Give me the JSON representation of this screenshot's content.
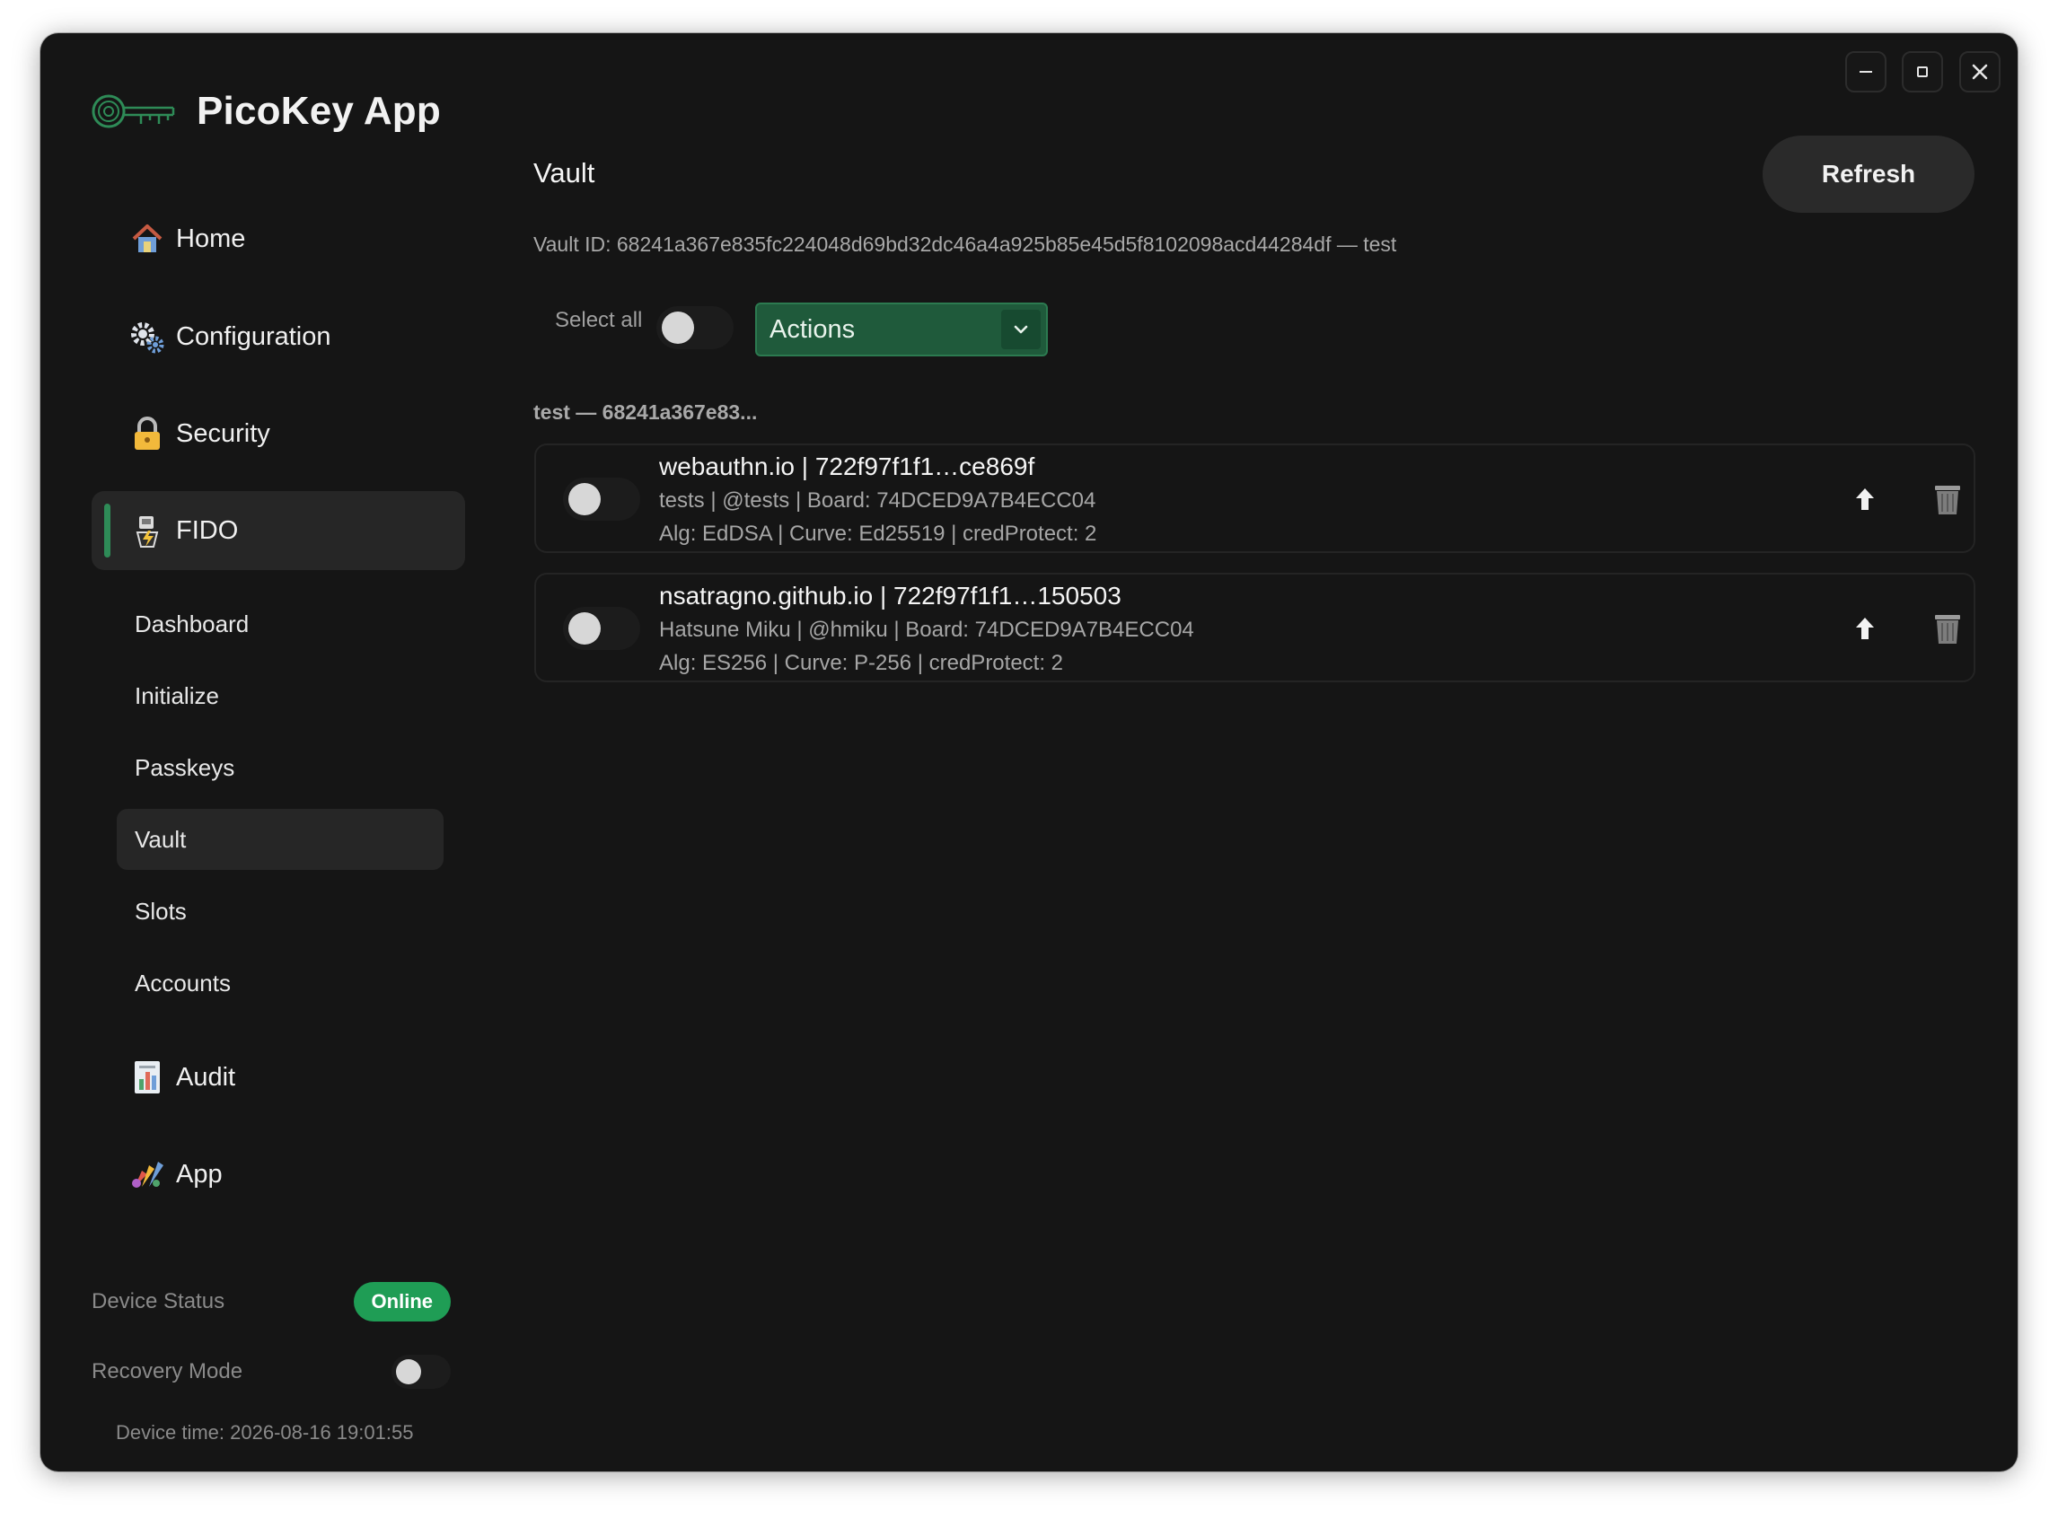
{
  "app": {
    "title": "PicoKey App"
  },
  "window_controls": {
    "minimize_icon": "minimize-icon",
    "maximize_icon": "maximize-icon",
    "close_icon": "close-icon"
  },
  "sidebar": {
    "items": [
      {
        "label": "Home",
        "icon": "house-icon"
      },
      {
        "label": "Configuration",
        "icon": "gear-icon"
      },
      {
        "label": "Security",
        "icon": "lock-icon"
      },
      {
        "label": "FIDO",
        "icon": "fido-key-icon"
      },
      {
        "label": "Audit",
        "icon": "chart-icon"
      },
      {
        "label": "App",
        "icon": "palette-icon"
      }
    ],
    "fido_subitems": [
      {
        "label": "Dashboard"
      },
      {
        "label": "Initialize"
      },
      {
        "label": "Passkeys"
      },
      {
        "label": "Vault"
      },
      {
        "label": "Slots"
      },
      {
        "label": "Accounts"
      }
    ],
    "device_status_label": "Device Status",
    "device_status_value": "Online",
    "recovery_mode_label": "Recovery Mode",
    "recovery_mode_on": false,
    "device_time": "Device time: 2026-08-16 19:01:55"
  },
  "main": {
    "title": "Vault",
    "refresh_label": "Refresh",
    "vault_id": "Vault ID: 68241a367e835fc224048d69bd32dc46a4a925b85e45d5f8102098acd44284df — test",
    "select_all_label": "Select all",
    "actions_label": "Actions",
    "group_label": "test — 68241a367e83...",
    "credentials": [
      {
        "line1": "webauthn.io  |  722f97f1f1…ce869f",
        "line2": "tests  |  @tests  |  Board: 74DCED9A7B4ECC04",
        "line3": "Alg: EdDSA  |  Curve: Ed25519  |  credProtect: 2"
      },
      {
        "line1": "nsatragno.github.io  |  722f97f1f1…150503",
        "line2": "Hatsune Miku  |  @hmiku  |  Board: 74DCED9A7B4ECC04",
        "line3": "Alg: ES256  |  Curve: P-256  |  credProtect: 2"
      }
    ]
  },
  "colors": {
    "accent_green": "#2e8b57",
    "online_badge": "#1f9d55",
    "actions_bg": "#1f5a3b",
    "window_bg": "#151515"
  }
}
